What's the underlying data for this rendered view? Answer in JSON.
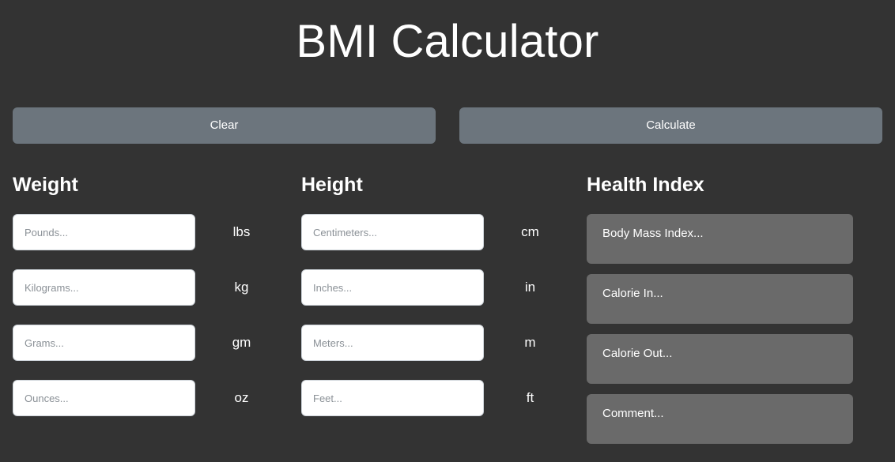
{
  "header": {
    "title": "BMI Calculator"
  },
  "toolbar": {
    "clear_label": "Clear",
    "calculate_label": "Calculate"
  },
  "weight": {
    "heading": "Weight",
    "fields": [
      {
        "placeholder": "Pounds...",
        "value": "",
        "unit": "lbs"
      },
      {
        "placeholder": "Kilograms...",
        "value": "",
        "unit": "kg"
      },
      {
        "placeholder": "Grams...",
        "value": "",
        "unit": "gm"
      },
      {
        "placeholder": "Ounces...",
        "value": "",
        "unit": "oz"
      }
    ]
  },
  "height": {
    "heading": "Height",
    "fields": [
      {
        "placeholder": "Centimeters...",
        "value": "",
        "unit": "cm"
      },
      {
        "placeholder": "Inches...",
        "value": "",
        "unit": "in"
      },
      {
        "placeholder": "Meters...",
        "value": "",
        "unit": "m"
      },
      {
        "placeholder": "Feet...",
        "value": "",
        "unit": "ft"
      }
    ]
  },
  "health_index": {
    "heading": "Health Index",
    "fields": [
      {
        "placeholder": "Body Mass Index...",
        "value": ""
      },
      {
        "placeholder": "Calorie In...",
        "value": ""
      },
      {
        "placeholder": "Calorie Out...",
        "value": ""
      },
      {
        "placeholder": "Comment...",
        "value": ""
      }
    ]
  },
  "colors": {
    "background": "#333333",
    "button": "#6c757d",
    "result_field": "#6a6a6a",
    "input_background": "#ffffff",
    "text": "#ffffff"
  }
}
